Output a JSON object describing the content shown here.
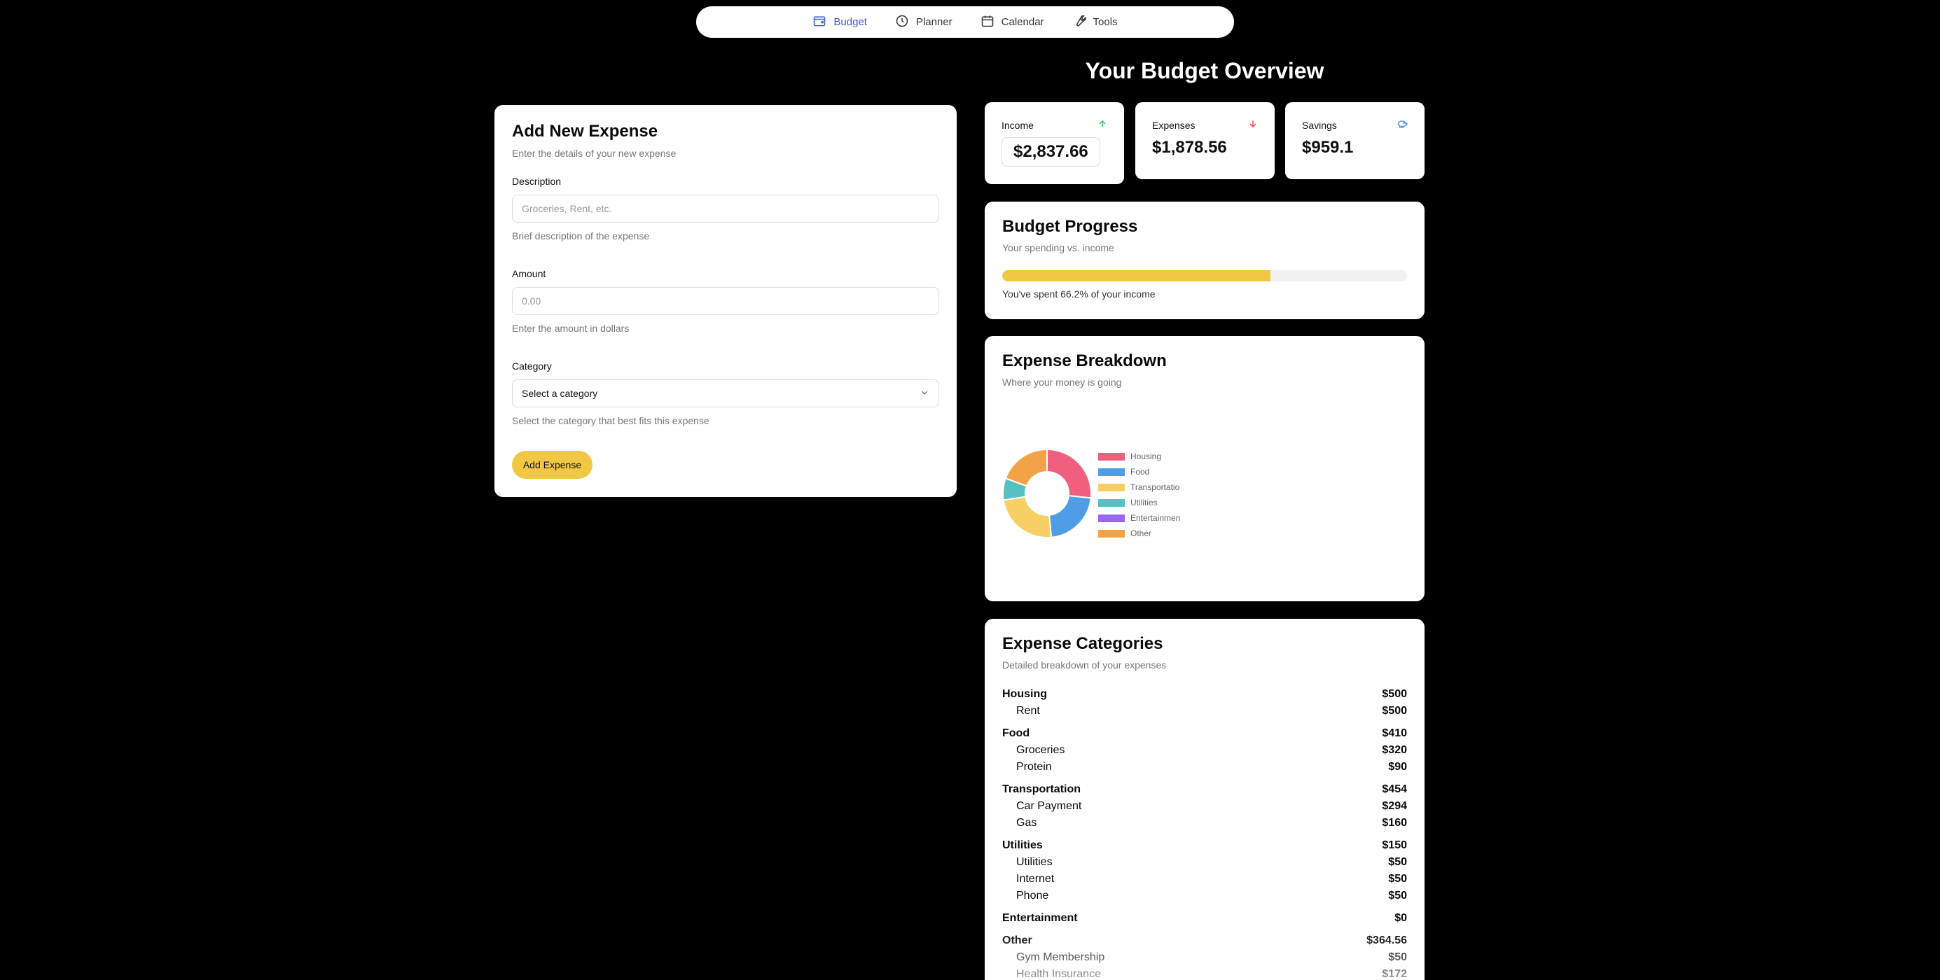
{
  "nav": {
    "items": [
      {
        "label": "Budget",
        "icon": "wallet-icon",
        "active": true
      },
      {
        "label": "Planner",
        "icon": "clock-icon",
        "active": false
      },
      {
        "label": "Calendar",
        "icon": "calendar-icon",
        "active": false
      },
      {
        "label": "Tools",
        "icon": "wrench-icon",
        "active": false
      }
    ]
  },
  "form": {
    "title": "Add New Expense",
    "subtitle": "Enter the details of your new expense",
    "description": {
      "label": "Description",
      "placeholder": "Groceries, Rent, etc.",
      "help": "Brief description of the expense"
    },
    "amount": {
      "label": "Amount",
      "placeholder": "0.00",
      "help": "Enter the amount in dollars"
    },
    "category": {
      "label": "Category",
      "selected": "Select a category",
      "help": "Select the category that best fits this expense"
    },
    "submit_label": "Add Expense"
  },
  "overview": {
    "title": "Your Budget Overview",
    "income": {
      "label": "Income",
      "value": "$2,837.66",
      "icon": "arrow-up-icon",
      "color": "#22c55e"
    },
    "expenses": {
      "label": "Expenses",
      "value": "$1,878.56",
      "icon": "arrow-down-icon",
      "color": "#ef4444"
    },
    "savings": {
      "label": "Savings",
      "value": "$959.1",
      "icon": "piggy-bank-icon",
      "color": "#3b82f6"
    }
  },
  "progress": {
    "title": "Budget Progress",
    "subtitle": "Your spending vs. income",
    "percent": 66.2,
    "text": "You've spent 66.2% of your income"
  },
  "breakdown": {
    "title": "Expense Breakdown",
    "subtitle": "Where your money is going"
  },
  "chart_data": {
    "type": "pie",
    "categories": [
      "Housing",
      "Food",
      "Transportation",
      "Utilities",
      "Entertainment",
      "Other"
    ],
    "legend_labels": [
      "Housing",
      "Food",
      "Transportatio",
      "Utilities",
      "Entertainmen",
      "Other"
    ],
    "values": [
      500,
      410,
      454,
      150,
      0,
      364.56
    ],
    "colors": [
      "#f0607e",
      "#4e9de6",
      "#f7cf62",
      "#58c0c0",
      "#9a66f5",
      "#f2a347"
    ],
    "legend_position": "right",
    "donut": true
  },
  "categories_panel": {
    "title": "Expense Categories",
    "subtitle": "Detailed breakdown of your expenses",
    "groups": [
      {
        "name": "Housing",
        "total": "$500",
        "items": [
          {
            "name": "Rent",
            "amount": "$500"
          }
        ]
      },
      {
        "name": "Food",
        "total": "$410",
        "items": [
          {
            "name": "Groceries",
            "amount": "$320"
          },
          {
            "name": "Protein",
            "amount": "$90"
          }
        ]
      },
      {
        "name": "Transportation",
        "total": "$454",
        "items": [
          {
            "name": "Car Payment",
            "amount": "$294"
          },
          {
            "name": "Gas",
            "amount": "$160"
          }
        ]
      },
      {
        "name": "Utilities",
        "total": "$150",
        "items": [
          {
            "name": "Utilities",
            "amount": "$50"
          },
          {
            "name": "Internet",
            "amount": "$50"
          },
          {
            "name": "Phone",
            "amount": "$50"
          }
        ]
      },
      {
        "name": "Entertainment",
        "total": "$0",
        "items": []
      },
      {
        "name": "Other",
        "total": "$364.56",
        "items": [
          {
            "name": "Gym Membership",
            "amount": "$50"
          },
          {
            "name": "Health Insurance",
            "amount": "$172"
          }
        ]
      }
    ]
  }
}
